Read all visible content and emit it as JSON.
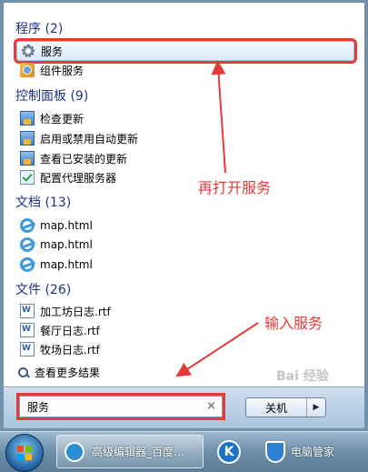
{
  "groups": {
    "programs": {
      "header": "程序 (2)",
      "items": [
        {
          "label": "服务",
          "icon": "gear-icon"
        },
        {
          "label": "组件服务",
          "icon": "component-services-icon"
        }
      ]
    },
    "control_panel": {
      "header": "控制面板 (9)",
      "items": [
        {
          "label": "检查更新",
          "icon": "control-panel-icon"
        },
        {
          "label": "启用或禁用自动更新",
          "icon": "control-panel-icon"
        },
        {
          "label": "查看已安装的更新",
          "icon": "control-panel-icon"
        },
        {
          "label": "配置代理服务器",
          "icon": "checklist-icon"
        }
      ]
    },
    "documents": {
      "header": "文档 (13)",
      "items": [
        {
          "label": "map.html",
          "icon": "ie-icon"
        },
        {
          "label": "map.html",
          "icon": "ie-icon"
        },
        {
          "label": "map.html",
          "icon": "ie-icon"
        }
      ]
    },
    "files": {
      "header": "文件 (26)",
      "items": [
        {
          "label": "加工坊日志.rtf",
          "icon": "document-icon"
        },
        {
          "label": "餐厅日志.rtf",
          "icon": "document-icon"
        },
        {
          "label": "牧场日志.rtf",
          "icon": "document-icon"
        }
      ]
    }
  },
  "see_more": "查看更多结果",
  "search": {
    "value": "服务",
    "clear": "×"
  },
  "shutdown": {
    "label": "关机",
    "arrow": "▶"
  },
  "taskbar": {
    "browser_task": "高级编辑器_百度...",
    "k_icon": "K",
    "pc_manager_task": "电脑管家"
  },
  "annotations": {
    "reopen": "再打开服务",
    "type": "输入服务"
  },
  "watermark": "Bai 经验",
  "colors": {
    "annotation": "#e53a3a",
    "header": "#1e3287"
  }
}
